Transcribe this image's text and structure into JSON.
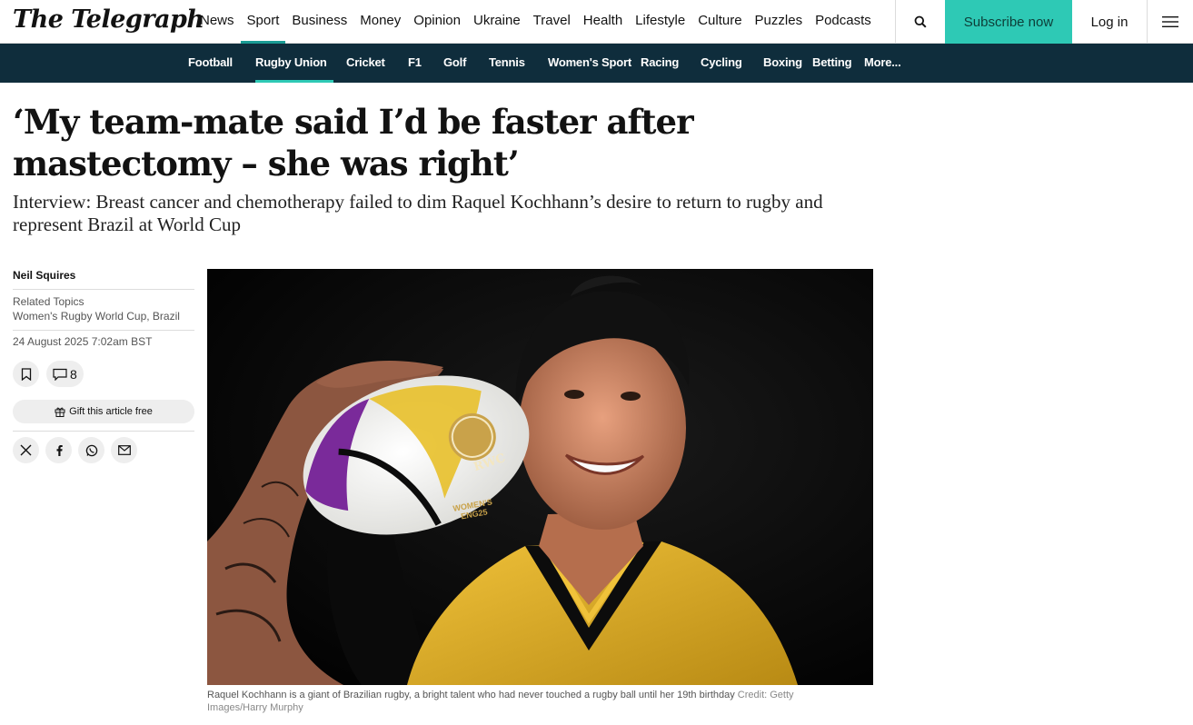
{
  "header": {
    "logo": "The Telegraph",
    "nav": [
      "News",
      "Sport",
      "Business",
      "Money",
      "Opinion",
      "Ukraine",
      "Travel",
      "Health",
      "Lifestyle",
      "Culture",
      "Puzzles",
      "Podcasts"
    ],
    "active_nav": "Sport",
    "subscribe_label": "Subscribe now",
    "login_label": "Log in"
  },
  "subnav": {
    "items": [
      "Football",
      "Rugby Union",
      "Cricket",
      "F1",
      "Golf",
      "Tennis",
      "Women's Sport",
      "Racing",
      "Cycling",
      "Boxing",
      "Betting",
      "More..."
    ],
    "active": "Rugby Union"
  },
  "article": {
    "headline": "‘My team-mate said I’d be faster after mastectomy – she was right’",
    "standfirst": "Interview: Breast cancer and chemotherapy failed to dim Raquel Kochhann’s desire to return to rugby and represent Brazil at World Cup",
    "author": "Neil Squires",
    "related_topics_label": "Related Topics",
    "related_topics": "Women's Rugby World Cup, Brazil",
    "date": "24 August 2025 7:02am BST",
    "comment_count": "8",
    "gift_label": "Gift this article free",
    "image": {
      "ball_logo": "RWC",
      "ball_text": "WOMEN'S ENG25"
    },
    "caption": "Raquel Kochhann is a giant of Brazilian rugby, a bright talent who had never touched a rugby ball until her 19th birthday",
    "credit": "Credit: Getty Images/Harry Murphy"
  },
  "colors": {
    "accent": "#2ec9b5",
    "subnav_bg": "#0f2d3c",
    "active_underline": "#1a9c95",
    "jersey_yellow": "#e0b328"
  }
}
